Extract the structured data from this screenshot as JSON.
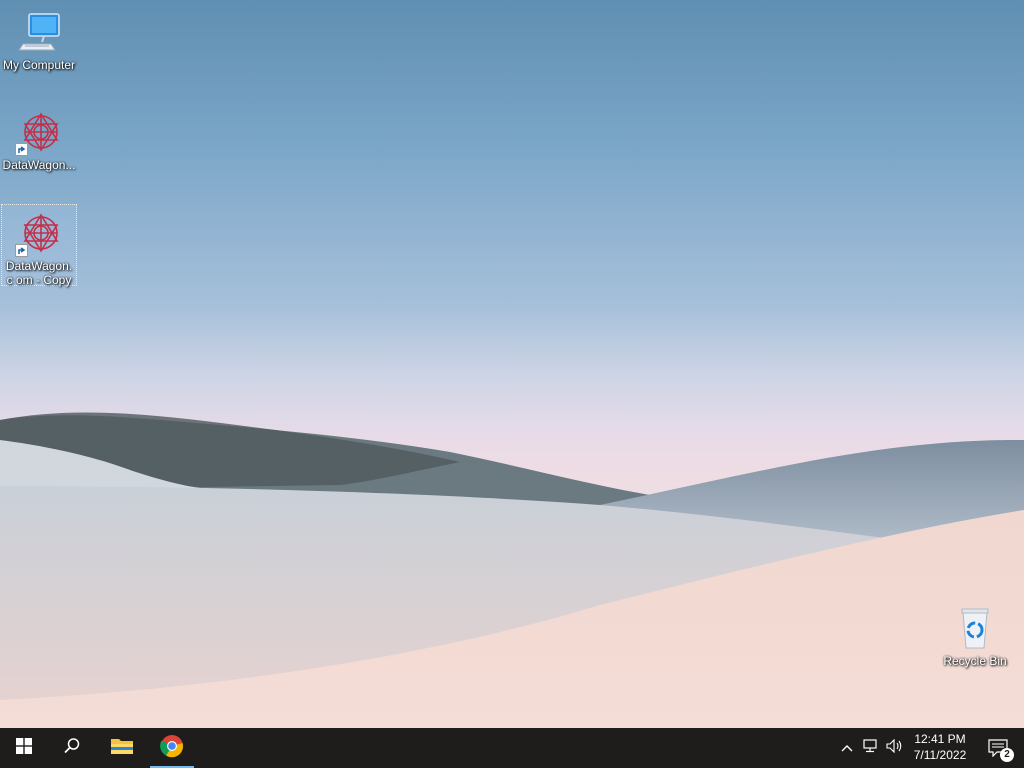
{
  "desktop": {
    "icons": [
      {
        "label": "My Computer",
        "icon": "computer-icon"
      },
      {
        "label": "DataWagon...",
        "icon": "datawagon-icon"
      },
      {
        "label": "DataWagon.c om - Copy",
        "icon": "datawagon-icon"
      },
      {
        "label": "Recycle Bin",
        "icon": "recycle-bin-icon"
      }
    ]
  },
  "taskbar": {
    "buttons": [
      {
        "name": "start",
        "icon": "windows-icon"
      },
      {
        "name": "search",
        "icon": "search-icon"
      },
      {
        "name": "file-explorer",
        "icon": "folder-icon"
      },
      {
        "name": "chrome",
        "icon": "chrome-icon"
      }
    ],
    "tray": {
      "icons": [
        "chevron-up-icon",
        "network-icon",
        "volume-icon"
      ],
      "time": "12:41 PM",
      "date": "7/11/2022",
      "notification_count": "2"
    }
  }
}
